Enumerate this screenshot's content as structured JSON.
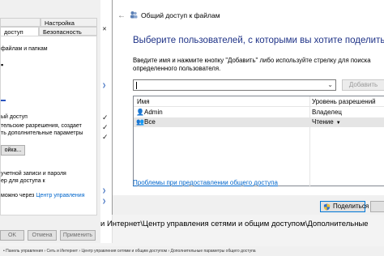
{
  "properties": {
    "tabs_row1": [
      "Настройка"
    ],
    "tabs_row2": [
      "доступ",
      "Безопасность"
    ],
    "section1": "файлам и папкам",
    "advanced_heading": "ый доступ",
    "advanced_line1": "тельские разрешения, создает",
    "advanced_line2": "ть дополнительные параметры",
    "advanced_button": "ойка...",
    "password_line1": "учетной записи и пароля",
    "password_line2": "ер для доступа к",
    "link_prefix": "можно через ",
    "link_text": "Центр управления",
    "buttons": {
      "ok": "OK",
      "cancel": "Отмена",
      "apply": "Применить"
    }
  },
  "background": {
    "address_text": "и Интернет\\Центр управления сетями и общим доступом\\Дополнительные",
    "crumb_text": "• Панель управления › Сеть и Интернет › Центр управления сетями и общим доступом › Дополнительные параметры общего доступа"
  },
  "dialog": {
    "title": "Общий доступ к файлам",
    "heading": "Выберите пользователей, с которыми вы хотите поделиться",
    "instructions": "Введите имя и нажмите кнопку \"Добавить\" либо используйте стрелку для поиска определенного пользователя.",
    "input_value": "",
    "add_button": "Добавить",
    "table": {
      "columns": [
        "Имя",
        "Уровень разрешений"
      ],
      "rows": [
        {
          "name": "Admin",
          "level": "Владелец",
          "selected": false,
          "icon": "user-icon"
        },
        {
          "name": "Все",
          "level": "Чтение",
          "selected": true,
          "icon": "group-icon"
        }
      ]
    },
    "help_link": "Проблемы при предоставлении общего доступа",
    "share_button": "Поделиться",
    "cancel_button": ""
  }
}
